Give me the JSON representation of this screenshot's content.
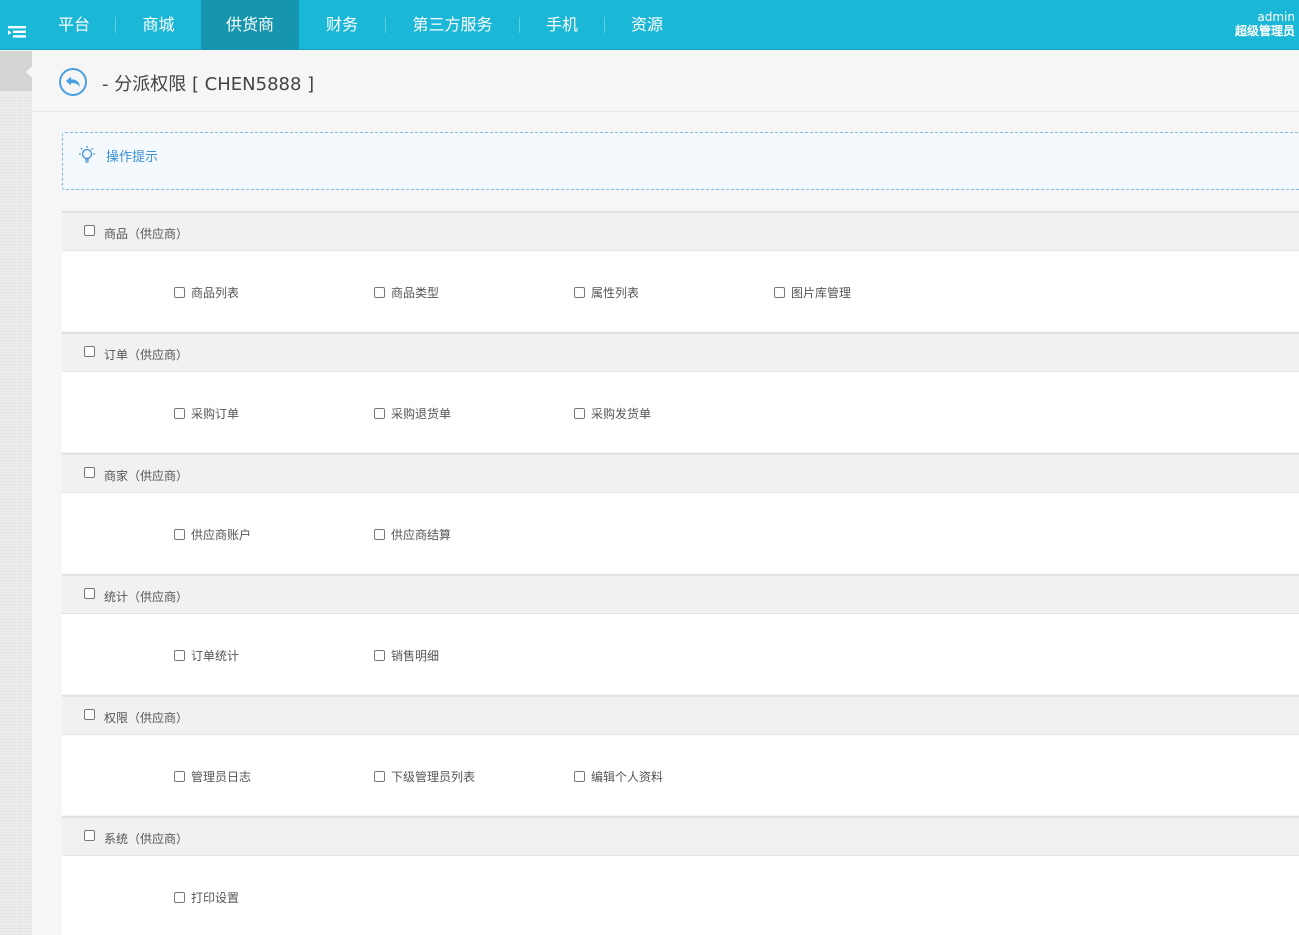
{
  "nav": {
    "items": [
      {
        "label": "平台"
      },
      {
        "label": "商城"
      },
      {
        "label": "供货商",
        "active": true
      },
      {
        "label": "财务"
      },
      {
        "label": "第三方服务"
      },
      {
        "label": "手机"
      },
      {
        "label": "资源"
      }
    ]
  },
  "user": {
    "name": "admin",
    "role": "超级管理员"
  },
  "page": {
    "title": "- 分派权限 [ CHEN5888 ]"
  },
  "tips": {
    "label": "操作提示"
  },
  "sections": [
    {
      "title": "商品（供应商）",
      "items": [
        "商品列表",
        "商品类型",
        "属性列表",
        "图片库管理"
      ]
    },
    {
      "title": "订单（供应商）",
      "items": [
        "采购订单",
        "采购退货单",
        "采购发货单"
      ]
    },
    {
      "title": "商家（供应商）",
      "items": [
        "供应商账户",
        "供应商结算"
      ]
    },
    {
      "title": "统计（供应商）",
      "items": [
        "订单统计",
        "销售明细"
      ]
    },
    {
      "title": "权限（供应商）",
      "items": [
        "管理员日志",
        "下级管理员列表",
        "编辑个人资料"
      ]
    },
    {
      "title": "系统（供应商）",
      "items": [
        "打印设置"
      ]
    }
  ],
  "colors": {
    "topbar": "#1bb7d6",
    "topbar_active": "#1596ae",
    "tips_text": "#3b8fd6",
    "tips_border": "#7fb8e6"
  },
  "icons": {
    "menu_toggle": "menu-list-icon",
    "back": "back-arrow-icon",
    "tips": "lightbulb-icon"
  }
}
